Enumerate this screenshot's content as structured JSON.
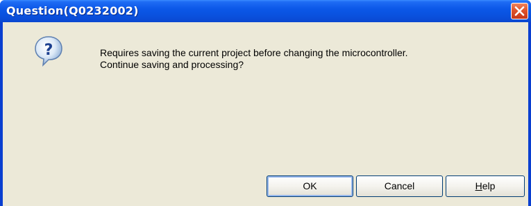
{
  "dialog": {
    "title": "Question(Q0232002)",
    "message_lines": [
      "Requires saving the current project before changing the microcontroller.",
      "Continue saving and processing?"
    ],
    "icon": "question-icon"
  },
  "buttons": {
    "ok_label": "OK",
    "cancel_label": "Cancel",
    "help_mnemonic": "H",
    "help_rest": "elp"
  },
  "colors": {
    "titlebar": "#0a50dc",
    "client_background": "#ece9d8",
    "close_button": "#e0532b",
    "button_border": "#003c74"
  }
}
